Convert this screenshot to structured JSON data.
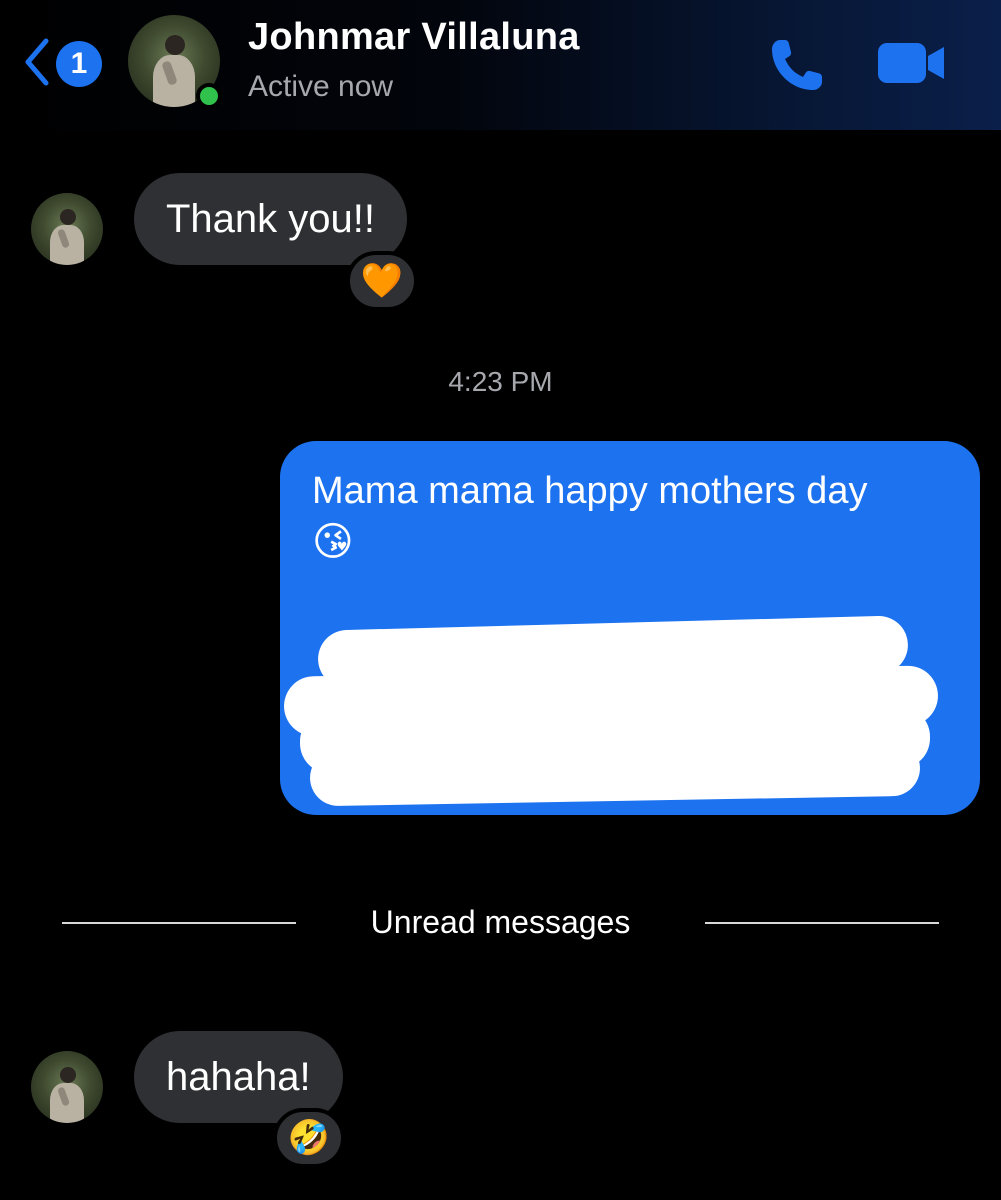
{
  "header": {
    "back_badge": "1",
    "contact_name": "Johnmar Villaluna",
    "status": "Active now",
    "call_icon": "phone-icon",
    "video_icon": "video-camera-icon",
    "accent": "#1d72f0"
  },
  "messages": [
    {
      "direction": "incoming",
      "text": "Thank you!!",
      "reaction": "🧡"
    },
    {
      "type": "timestamp",
      "text": "4:23 PM"
    },
    {
      "direction": "outgoing",
      "text": "Mama mama happy mothers day",
      "emoji": "😘",
      "redacted": true
    },
    {
      "type": "divider",
      "text": "Unread messages"
    },
    {
      "direction": "incoming",
      "text": "hahaha!",
      "reaction": "🤣"
    }
  ]
}
